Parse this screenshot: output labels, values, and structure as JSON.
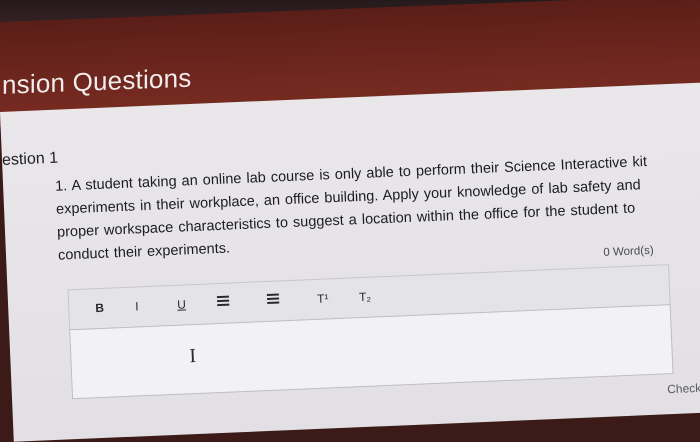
{
  "header": {
    "title": "nsion Questions"
  },
  "question": {
    "label": "estion 1",
    "text": "1. A student taking an online lab course is only able to perform their Science Interactive kit experiments in their workplace, an office building. Apply your knowledge of lab safety and proper workspace characteristics to suggest a location within the office for the student to conduct their experiments."
  },
  "editor": {
    "word_count": "0 Word(s)",
    "toolbar": {
      "bold": "B",
      "italic": "I",
      "underline": "U",
      "superscript": "T¹",
      "subscript": "T₂"
    },
    "cursor": "I"
  },
  "footer": {
    "check_label": "Check A"
  }
}
